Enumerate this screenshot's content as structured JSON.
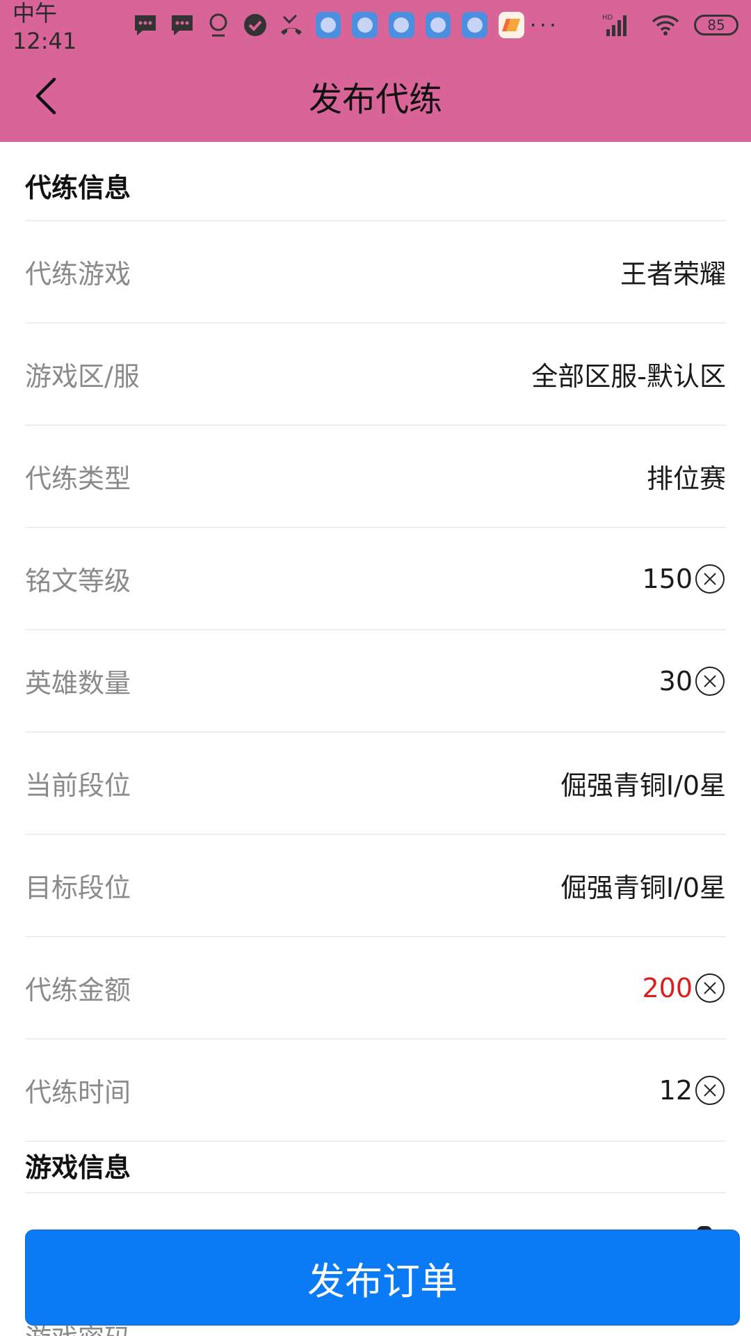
{
  "status_bar": {
    "time": "中午12:41",
    "battery": "85",
    "more": "···",
    "network_hd": "HD"
  },
  "header": {
    "title": "发布代练"
  },
  "section_boost": {
    "title": "代练信息",
    "rows": [
      {
        "label": "代练游戏",
        "value": "王者荣耀"
      },
      {
        "label": "游戏区/服",
        "value": "全部区服-默认区"
      },
      {
        "label": "代练类型",
        "value": "排位赛"
      },
      {
        "label": "铭文等级",
        "value": "150"
      },
      {
        "label": "英雄数量",
        "value": "30"
      },
      {
        "label": "当前段位",
        "value": "倔强青铜I/0星"
      },
      {
        "label": "目标段位",
        "value": "倔强青铜I/0星"
      },
      {
        "label": "代练金额",
        "value": "200"
      },
      {
        "label": "代练时间",
        "value": "12"
      }
    ]
  },
  "section_game": {
    "title": "游戏信息",
    "next_row_label": "游戏密码"
  },
  "footer": {
    "publish_label": "发布订单"
  },
  "colors": {
    "header_bg": "#d96497",
    "button_bg": "#0a7bf5",
    "amount_color": "#d81e1e",
    "label_color": "#8a8a8a"
  }
}
